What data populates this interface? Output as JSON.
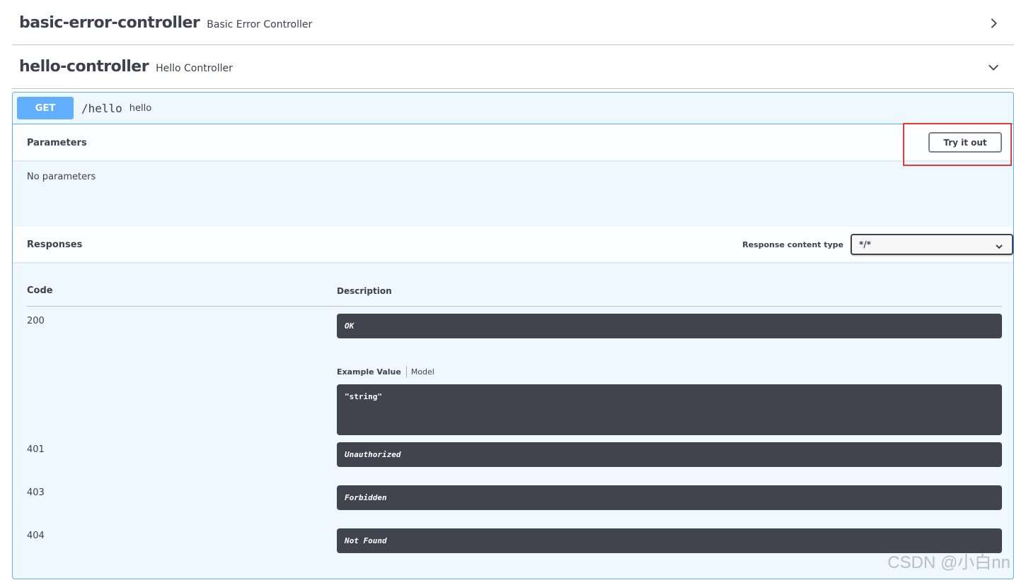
{
  "tags": [
    {
      "title": "basic-error-controller",
      "description": "Basic Error Controller",
      "expanded": false,
      "chevron_icon": "chevron-right-icon"
    },
    {
      "title": "hello-controller",
      "description": "Hello Controller",
      "expanded": true,
      "chevron_icon": "chevron-down-icon"
    }
  ],
  "operation": {
    "method": "GET",
    "path": "/hello",
    "summary": "hello",
    "method_color": "#61affe"
  },
  "parameters": {
    "title": "Parameters",
    "try_button": "Try it out",
    "empty_text": "No parameters"
  },
  "responses": {
    "title": "Responses",
    "content_type_label": "Response content type",
    "content_type_value": "*/*",
    "columns": {
      "code": "Code",
      "description": "Description"
    },
    "rows": [
      {
        "code": "200",
        "description": "OK"
      },
      {
        "code": "401",
        "description": "Unauthorized"
      },
      {
        "code": "403",
        "description": "Forbidden"
      },
      {
        "code": "404",
        "description": "Not Found"
      }
    ],
    "example_tabs": {
      "example": "Example Value",
      "model": "Model"
    },
    "example_value": "\"string\""
  },
  "watermark": "CSDN @小白nn",
  "colors": {
    "highlight": "#e03c3c",
    "dark_panel": "#41444e"
  }
}
